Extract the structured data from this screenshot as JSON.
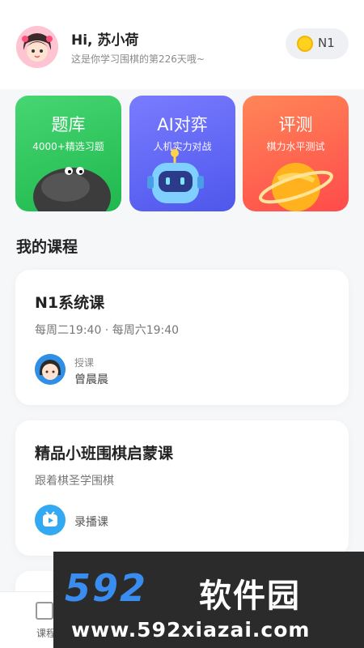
{
  "header": {
    "greeting": "Hi, 苏小荷",
    "subtitle": "这是你学习围棋的第226天哦~",
    "level": "N1"
  },
  "tiles": [
    {
      "title": "题库",
      "subtitle": "4000+精选习题"
    },
    {
      "title": "AI对弈",
      "subtitle": "人机实力对战"
    },
    {
      "title": "评测",
      "subtitle": "棋力水平测试"
    }
  ],
  "section": {
    "title": "我的课程"
  },
  "courses": [
    {
      "title": "N1系统课",
      "schedule": "每周二19:40 · 每周六19:40",
      "teacher_label": "授课",
      "teacher_name": "曾晨晨"
    },
    {
      "title": "精品小班围棋启蒙课",
      "subtitle": "跟着棋圣学围棋",
      "type_label": "录播课"
    }
  ],
  "tabbar": {
    "tab1_label": "课程"
  },
  "watermark": {
    "brand_num": "592",
    "brand_text": "软件园",
    "url": "www.592xiazai.com"
  },
  "colors": {
    "green": "#2dc65d",
    "purple": "#5a60f0",
    "red": "#ff5a4e",
    "accent_blue": "#33a8f3"
  }
}
